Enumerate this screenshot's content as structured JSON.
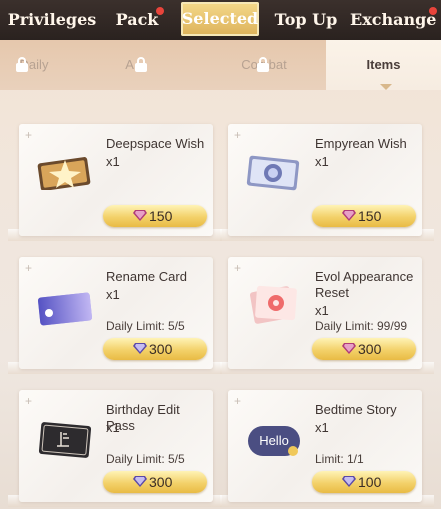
{
  "top_nav": {
    "tabs": [
      {
        "label": "Privileges",
        "active": false,
        "badge": false
      },
      {
        "label": "Pack",
        "active": false,
        "badge": true
      },
      {
        "label": "Selected",
        "active": true,
        "badge": false
      },
      {
        "label": "Top Up",
        "active": false,
        "badge": false
      },
      {
        "label": "Exchange",
        "active": false,
        "badge": true
      }
    ]
  },
  "sub_nav": {
    "tabs": [
      {
        "label": "Daily",
        "locked": true,
        "active": false
      },
      {
        "label": "A...",
        "locked": true,
        "active": false
      },
      {
        "label": "Combat",
        "locked": true,
        "active": false
      },
      {
        "label": "Items",
        "locked": false,
        "active": true
      }
    ]
  },
  "items": [
    {
      "name": "Deepspace Wish",
      "qty": "x1",
      "limit": "",
      "price": "150",
      "icon": "deepspace-wish-icon"
    },
    {
      "name": "Empyrean Wish",
      "qty": "x1",
      "limit": "",
      "price": "150",
      "icon": "empyrean-wish-icon"
    },
    {
      "name": "Rename Card",
      "qty": "x1",
      "limit": "Daily Limit: 5/5",
      "price": "300",
      "icon": "rename-card-icon"
    },
    {
      "name": "Evol Appearance Reset",
      "qty": "x1",
      "limit": "Daily Limit: 99/99",
      "price": "300",
      "icon": "evol-reset-icon"
    },
    {
      "name": "Birthday Edit Pass",
      "qty": "x1",
      "limit": "Daily Limit: 5/5",
      "price": "300",
      "icon": "birthday-pass-icon"
    },
    {
      "name": "Bedtime Story",
      "qty": "x1",
      "limit": "Limit: 1/1",
      "price": "100",
      "icon": "bedtime-story-icon",
      "bubble_text": "Hello"
    }
  ],
  "colors": {
    "accent_gold": "#f3d16a",
    "nav_bg": "#2a221f",
    "badge_red": "#e8443b",
    "gem": "#b03a78"
  }
}
